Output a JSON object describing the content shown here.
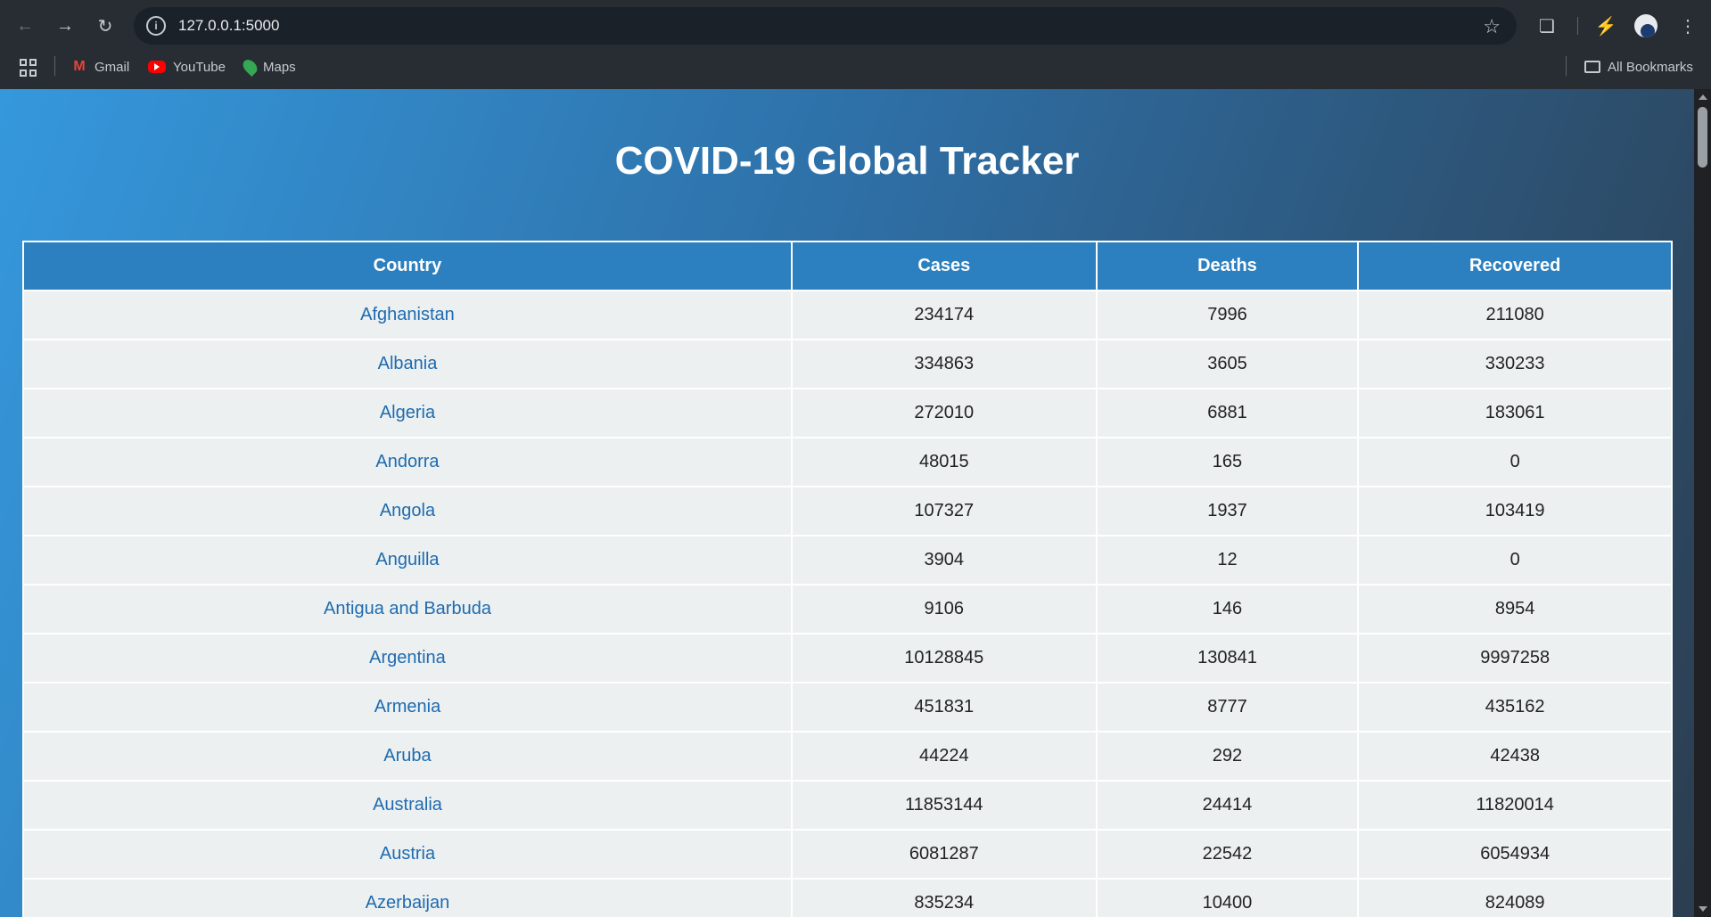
{
  "browser": {
    "url": "127.0.0.1:5000",
    "bookmarks": [
      {
        "label": "Gmail",
        "icon": "gmail-icon"
      },
      {
        "label": "YouTube",
        "icon": "youtube-icon"
      },
      {
        "label": "Maps",
        "icon": "maps-icon"
      }
    ],
    "all_bookmarks_label": "All Bookmarks"
  },
  "page": {
    "title": "COVID-19 Global Tracker",
    "table": {
      "headers": [
        "Country",
        "Cases",
        "Deaths",
        "Recovered"
      ],
      "rows": [
        {
          "country": "Afghanistan",
          "cases": "234174",
          "deaths": "7996",
          "recovered": "211080"
        },
        {
          "country": "Albania",
          "cases": "334863",
          "deaths": "3605",
          "recovered": "330233"
        },
        {
          "country": "Algeria",
          "cases": "272010",
          "deaths": "6881",
          "recovered": "183061"
        },
        {
          "country": "Andorra",
          "cases": "48015",
          "deaths": "165",
          "recovered": "0"
        },
        {
          "country": "Angola",
          "cases": "107327",
          "deaths": "1937",
          "recovered": "103419"
        },
        {
          "country": "Anguilla",
          "cases": "3904",
          "deaths": "12",
          "recovered": "0"
        },
        {
          "country": "Antigua and Barbuda",
          "cases": "9106",
          "deaths": "146",
          "recovered": "8954"
        },
        {
          "country": "Argentina",
          "cases": "10128845",
          "deaths": "130841",
          "recovered": "9997258"
        },
        {
          "country": "Armenia",
          "cases": "451831",
          "deaths": "8777",
          "recovered": "435162"
        },
        {
          "country": "Aruba",
          "cases": "44224",
          "deaths": "292",
          "recovered": "42438"
        },
        {
          "country": "Australia",
          "cases": "11853144",
          "deaths": "24414",
          "recovered": "11820014"
        },
        {
          "country": "Austria",
          "cases": "6081287",
          "deaths": "22542",
          "recovered": "6054934"
        },
        {
          "country": "Azerbaijan",
          "cases": "835234",
          "deaths": "10400",
          "recovered": "824089"
        }
      ]
    }
  }
}
